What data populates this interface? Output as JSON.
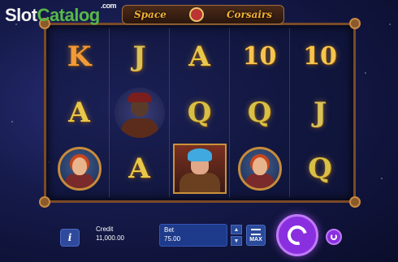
{
  "watermark": {
    "part1": "Slot",
    "part2": "Catalog",
    "part3": ".com"
  },
  "game": {
    "title_left": "Space",
    "title_right": "Corsairs"
  },
  "reels": [
    [
      "K",
      "J",
      "A",
      "10",
      "10"
    ],
    [
      "A",
      "pirate",
      "Q",
      "Q",
      "J"
    ],
    [
      "heroine",
      "A",
      "hero",
      "heroine",
      "Q"
    ]
  ],
  "controls": {
    "info_label": "i",
    "credit_label": "Credit",
    "credit_value": "11,000.00",
    "bet_label": "Bet",
    "bet_value": "75.00",
    "bet_up": "▲",
    "bet_down": "▼",
    "max_label": "MAX"
  },
  "colors": {
    "spin": "#8a2fe0",
    "panel": "#1e3a8a",
    "frame": "#7a4a28"
  }
}
